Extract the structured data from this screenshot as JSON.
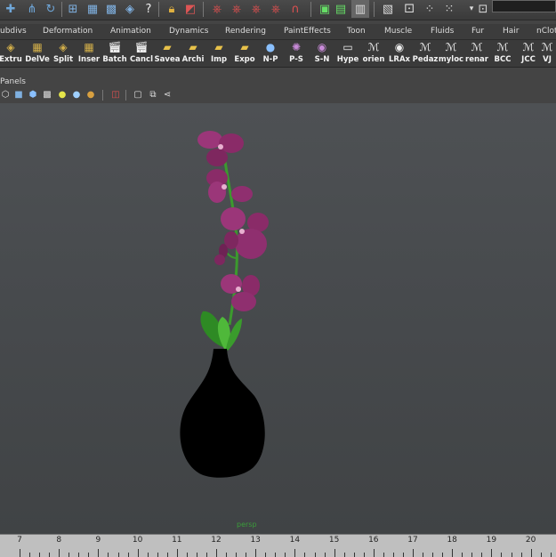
{
  "toolbar": {
    "icons": [
      "move-icon",
      "component-icon",
      "lasso-icon",
      "snap-grid-icon",
      "snap-curve-icon",
      "snap-point-icon",
      "snap-surface-icon",
      "help-icon",
      "lock-icon",
      "history-icon",
      "render-icon",
      "ipr-icon",
      "render-settings-icon",
      "hypershade-icon",
      "script-icon",
      "channel-box-icon",
      "attribute-editor-icon",
      "outliner-icon",
      "tool-settings-icon",
      "panel-layout-icon",
      "camera-icon",
      "numeric-input-icon"
    ]
  },
  "menu_tabs": [
    "ubdivs",
    "Deformation",
    "Animation",
    "Dynamics",
    "Rendering",
    "PaintEffects",
    "Toon",
    "Muscle",
    "Fluids",
    "Fur",
    "Hair",
    "nClot"
  ],
  "shelf": [
    {
      "label": "Extru",
      "icon": "extrude-icon"
    },
    {
      "label": "DelVe",
      "icon": "delete-vertex-icon"
    },
    {
      "label": "Split",
      "icon": "split-polygon-icon"
    },
    {
      "label": "Inser",
      "icon": "insert-edge-icon"
    },
    {
      "label": "Batch",
      "icon": "batch-render-icon"
    },
    {
      "label": "Cancl",
      "icon": "cancel-render-icon"
    },
    {
      "label": "Savea",
      "icon": "save-as-folder-icon"
    },
    {
      "label": "Archi",
      "icon": "archive-folder-icon"
    },
    {
      "label": "Imp",
      "icon": "import-folder-icon"
    },
    {
      "label": "Expo",
      "icon": "export-folder-icon"
    },
    {
      "label": "N-P",
      "icon": "sphere-icon"
    },
    {
      "label": "P-S",
      "icon": "particle-icon"
    },
    {
      "label": "S-N",
      "icon": "nurbs-sphere-icon"
    },
    {
      "label": "Hype",
      "icon": "hypergraph-icon"
    },
    {
      "label": "orien",
      "icon": "orient-icon"
    },
    {
      "label": "LRAx",
      "icon": "eye-icon"
    },
    {
      "label": "Pedaz",
      "icon": "mel-script-icon"
    },
    {
      "label": "myloc",
      "icon": "mel-script-icon"
    },
    {
      "label": "renar",
      "icon": "mel-script-icon"
    },
    {
      "label": "BCC",
      "icon": "mel-script-icon"
    },
    {
      "label": "JCC",
      "icon": "mel-script-icon"
    },
    {
      "label": "VJ",
      "icon": "mel-script-icon"
    }
  ],
  "panel_menu": {
    "label": "Panels"
  },
  "panel_toolbar": {
    "icons": [
      "wireframe-cube-icon",
      "smooth-shade-icon",
      "textured-cube-icon",
      "checker-icon",
      "lights-icon",
      "default-light-icon",
      "shadow-icon",
      "xray-icon",
      "isolate-select-icon",
      "camera-frame-icon",
      "grid-toggle-icon",
      "share-icon"
    ]
  },
  "viewport": {
    "camera_label": "persp"
  },
  "timeline": {
    "ticks": [
      7,
      8,
      9,
      10,
      11,
      12,
      13,
      14,
      15,
      16,
      17,
      18,
      19,
      20
    ]
  },
  "colors": {
    "flower": "#8f2f6f",
    "vase": "#000000",
    "leaf": "#2f9a2a",
    "camera_label": "#3a9c3a"
  }
}
